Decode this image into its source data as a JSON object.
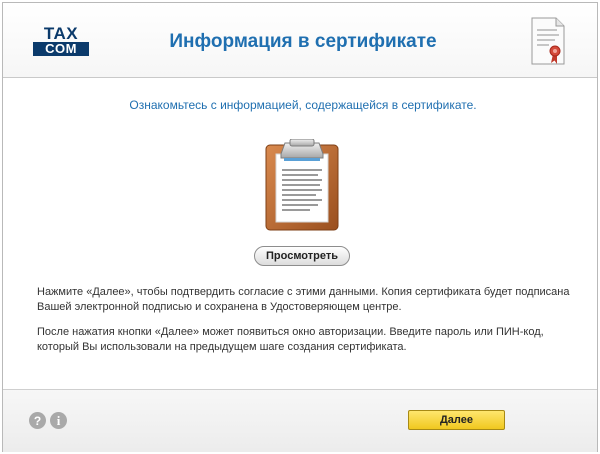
{
  "header": {
    "logo_top": "TAX",
    "logo_bottom": "COM",
    "title": "Информация в сертификате"
  },
  "main": {
    "subtitle": "Ознакомьтесь с информацией, содержащейся в сертификате.",
    "view_button": "Просмотреть",
    "paragraph1": "Нажмите «Далее», чтобы подтвердить согласие с этими данными. Копия сертификата будет подписана Вашей электронной подписью и сохранена в Удостоверяющем центре.",
    "paragraph2": "После нажатия кнопки «Далее» может появиться окно авторизации. Введите пароль или ПИН-код, который Вы использовали на предыдущем шаге создания сертификата."
  },
  "footer": {
    "help_glyph": "?",
    "info_glyph": "i",
    "next_button": "Далее"
  },
  "icons": [
    "certificate-icon",
    "clipboard-icon",
    "help-icon",
    "info-icon"
  ],
  "colors": {
    "title": "#1f6fb0",
    "next_button": "#f5d232",
    "logo": "#0b3a6b"
  }
}
